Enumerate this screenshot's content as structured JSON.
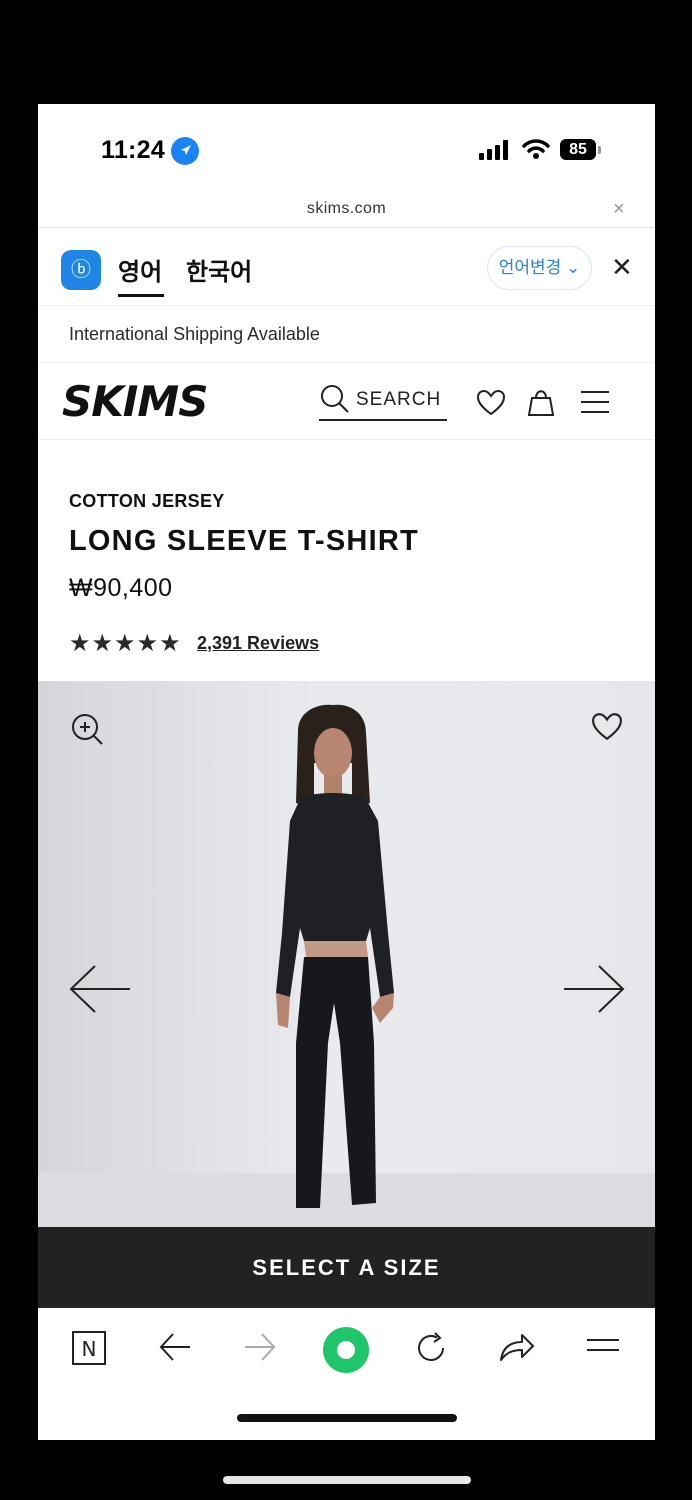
{
  "status_bar": {
    "time": "11:24",
    "battery": "85"
  },
  "url_bar": {
    "url": "skims.com",
    "close_label": "×"
  },
  "translate_bar": {
    "icon_label": "ⓑ",
    "tab_source": "영어",
    "tab_target": "한국어",
    "change_language": "언어변경 ⌄",
    "close_label": "✕"
  },
  "banner": {
    "shipping": "International Shipping Available"
  },
  "header": {
    "logo": "SKIMS",
    "search_label": "SEARCH"
  },
  "product": {
    "category": "COTTON JERSEY",
    "title": "LONG SLEEVE T-SHIRT",
    "price": "₩90,400",
    "stars": "★★★★★",
    "rating_stars": 5,
    "reviews": "2,391 Reviews"
  },
  "cta": {
    "select_size": "SELECT A SIZE"
  },
  "icons": {
    "status": [
      "location-arrow-icon",
      "signal-icon",
      "wifi-icon",
      "battery-icon"
    ],
    "header": [
      "search-icon",
      "heart-icon",
      "shopping-bag-icon",
      "menu-icon"
    ],
    "image": [
      "zoom-in-icon",
      "heart-icon",
      "arrow-left-icon",
      "arrow-right-icon"
    ],
    "toolbar": [
      "n-browser-icon",
      "back-icon",
      "forward-icon",
      "home-circle-icon",
      "reload-icon",
      "share-icon",
      "menu-icon"
    ]
  },
  "colors": {
    "accent_green": "#1fc56a",
    "translate_blue": "#1f86e8",
    "cta_bg": "#222222"
  }
}
